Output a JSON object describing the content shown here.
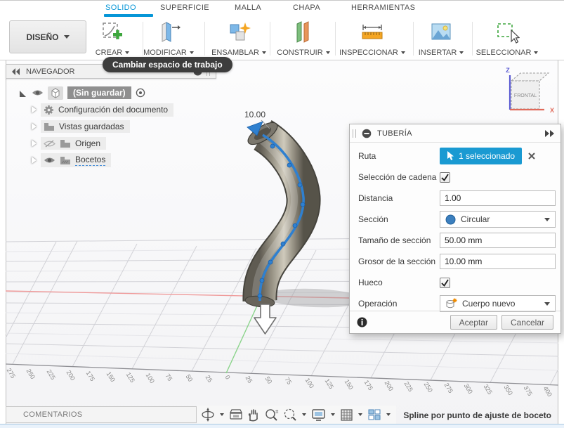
{
  "tabs": [
    {
      "label": "SOLIDO",
      "active": true
    },
    {
      "label": "SUPERFICIE",
      "active": false
    },
    {
      "label": "MALLA",
      "active": false
    },
    {
      "label": "CHAPA",
      "active": false
    },
    {
      "label": "HERRAMIENTAS",
      "active": false
    }
  ],
  "workspace": {
    "label": "DISEÑO"
  },
  "toolbar": [
    {
      "label": "CREAR"
    },
    {
      "label": "MODIFICAR"
    },
    {
      "label": "ENSAMBLAR"
    },
    {
      "label": "CONSTRUIR"
    },
    {
      "label": "INSPECCIONAR"
    },
    {
      "label": "INSERTAR"
    },
    {
      "label": "SELECCIONAR"
    }
  ],
  "tooltip": {
    "text": "Cambiar espacio de trabajo"
  },
  "navigator": {
    "title": "NAVEGADOR",
    "root_label": "(Sin guardar)",
    "items": [
      {
        "label": "Configuración del documento"
      },
      {
        "label": "Vistas guardadas"
      },
      {
        "label": "Origen"
      },
      {
        "label": "Bocetos"
      }
    ]
  },
  "viewcube": {
    "face_label": "FRONTAL",
    "z_label": "Z",
    "x_label": "X"
  },
  "viewport": {
    "dimension_label": "10.00",
    "ruler_labels": [
      "275",
      "250",
      "225",
      "200",
      "175",
      "150",
      "125",
      "100",
      "75",
      "50",
      "25",
      "0",
      "25",
      "50",
      "75",
      "100",
      "125",
      "150",
      "175",
      "200",
      "225",
      "250",
      "275",
      "300",
      "325",
      "350",
      "375",
      "400"
    ]
  },
  "dialog": {
    "title": "TUBERÍA",
    "fields": {
      "ruta": {
        "label": "Ruta",
        "value": "1 seleccionado"
      },
      "cadena": {
        "label": "Selección de cadena",
        "checked": true
      },
      "distancia": {
        "label": "Distancia",
        "value": "1.00"
      },
      "seccion": {
        "label": "Sección",
        "value": "Circular"
      },
      "tamano": {
        "label": "Tamaño de sección",
        "value": "50.00 mm"
      },
      "grosor": {
        "label": "Grosor de la sección",
        "value": "10.00 mm"
      },
      "hueco": {
        "label": "Hueco",
        "checked": true
      },
      "operacion": {
        "label": "Operación",
        "value": "Cuerpo nuevo"
      }
    },
    "buttons": {
      "accept": "Aceptar",
      "cancel": "Cancelar"
    }
  },
  "bottom": {
    "comments_label": "COMENTARIOS",
    "status": "Spline por punto de ajuste de boceto"
  },
  "colors": {
    "accent": "#0696d7",
    "selection_blue": "#1a9ad2",
    "path_blue": "#2f80d0"
  }
}
